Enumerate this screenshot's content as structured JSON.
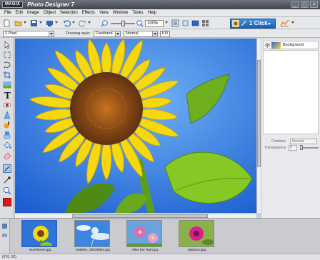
{
  "window": {
    "logo": "MAGIX",
    "title": "Photo Designer 7",
    "buttons": [
      "_",
      "□",
      "×"
    ]
  },
  "menu": [
    "File",
    "Edit",
    "Image",
    "Object",
    "Selection",
    "Effects",
    "View",
    "Window",
    "Tasks",
    "Help"
  ],
  "toolbar": {
    "zoom_value": "100%",
    "one_click_label": "1 Click"
  },
  "options": {
    "brush_size": "2 Pixel",
    "drawing_style_label": "Drawing style:",
    "drawing_style": "Freehand",
    "mode": "Normal",
    "opacity": "100"
  },
  "layers": {
    "items": [
      {
        "name": "Background"
      }
    ],
    "combine_label": "Combine",
    "combine_value": "Normal",
    "transparency_label": "Transparency",
    "transparency_value": "0"
  },
  "filmstrip": [
    {
      "name": "SunFlower.jpg",
      "selected": true
    },
    {
      "name": "586694_19539864.jpg",
      "selected": false
    },
    {
      "name": "After the Rain.jpg",
      "selected": false
    },
    {
      "name": "Balance.jpg",
      "selected": false
    }
  ],
  "status": {
    "text": "(676, 92)"
  },
  "colors": {
    "accent": "#1a5fb0",
    "sky": "#2f74d8",
    "petal": "#f5d20b",
    "leaf": "#7fc21d",
    "selected": "#2d64c8"
  }
}
